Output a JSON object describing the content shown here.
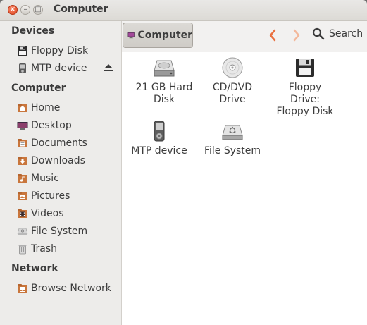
{
  "window": {
    "title": "Computer",
    "close_symbol": "×",
    "minimize_symbol": "–",
    "maximize_symbol": "□"
  },
  "sidebar": {
    "sections": [
      {
        "heading": "Devices",
        "items": [
          {
            "label": "Floppy Disk",
            "icon": "floppy-disk-icon"
          },
          {
            "label": "MTP device",
            "icon": "mtp-device-icon",
            "eject": true
          }
        ]
      },
      {
        "heading": "Computer",
        "items": [
          {
            "label": "Home",
            "icon": "home-folder-icon"
          },
          {
            "label": "Desktop",
            "icon": "desktop-icon"
          },
          {
            "label": "Documents",
            "icon": "documents-folder-icon"
          },
          {
            "label": "Downloads",
            "icon": "downloads-folder-icon"
          },
          {
            "label": "Music",
            "icon": "music-folder-icon"
          },
          {
            "label": "Pictures",
            "icon": "pictures-folder-icon"
          },
          {
            "label": "Videos",
            "icon": "videos-folder-icon"
          },
          {
            "label": "File System",
            "icon": "file-system-icon"
          },
          {
            "label": "Trash",
            "icon": "trash-icon"
          }
        ]
      },
      {
        "heading": "Network",
        "items": [
          {
            "label": "Browse Network",
            "icon": "network-icon"
          }
        ]
      }
    ]
  },
  "toolbar": {
    "path_label": "Computer",
    "search_label": "Search"
  },
  "main": {
    "items": [
      {
        "line1": "21 GB Hard",
        "line2": "Disk",
        "line3": "",
        "icon": "hard-disk-icon"
      },
      {
        "line1": "CD/DVD",
        "line2": "Drive",
        "line3": "",
        "icon": "optical-drive-icon"
      },
      {
        "line1": "Floppy",
        "line2": "Drive:",
        "line3": "Floppy Disk",
        "icon": "floppy-drive-icon"
      },
      {
        "line1": "MTP device",
        "line2": "",
        "line3": "",
        "icon": "media-player-icon"
      },
      {
        "line1": "File System",
        "line2": "",
        "line3": "",
        "icon": "file-system-drive-icon"
      }
    ]
  },
  "colors": {
    "close_button": "#e0461f",
    "nav_arrow": "#e9703f",
    "sidebar_bg": "#edecea",
    "content_bg": "#ffffff"
  }
}
